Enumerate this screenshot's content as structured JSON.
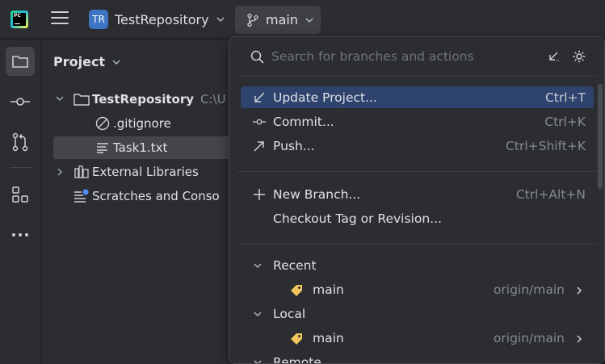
{
  "title_bar": {
    "app_logo_text": "PC",
    "project_avatar": "TR",
    "project_name": "TestRepository",
    "branch": "main"
  },
  "project_panel": {
    "title": "Project",
    "tree": [
      {
        "label": "TestRepository",
        "hint": "C:\\U"
      },
      {
        "label": ".gitignore"
      },
      {
        "label": "Task1.txt"
      },
      {
        "label": "External Libraries"
      },
      {
        "label": "Scratches and Conso"
      }
    ]
  },
  "branch_popup": {
    "search_placeholder": "Search for branches and actions",
    "actions": [
      {
        "label": "Update Project...",
        "shortcut": "Ctrl+T",
        "icon": "update-arrow-icon"
      },
      {
        "label": "Commit...",
        "shortcut": "Ctrl+K",
        "icon": "commit-icon"
      },
      {
        "label": "Push...",
        "shortcut": "Ctrl+Shift+K",
        "icon": "push-arrow-icon"
      },
      {
        "label": "New Branch...",
        "shortcut": "Ctrl+Alt+N",
        "icon": "plus-icon"
      },
      {
        "label": "Checkout Tag or Revision..."
      }
    ],
    "groups": [
      {
        "label": "Recent",
        "branches": [
          {
            "name": "main",
            "tracking": "origin/main"
          }
        ]
      },
      {
        "label": "Local",
        "branches": [
          {
            "name": "main",
            "tracking": "origin/main"
          }
        ]
      },
      {
        "label": "Remote"
      }
    ]
  },
  "colors": {
    "accent_selection": "#2e436e",
    "branch_tag": "#f2c55c",
    "avatar": "#3d74c4"
  }
}
